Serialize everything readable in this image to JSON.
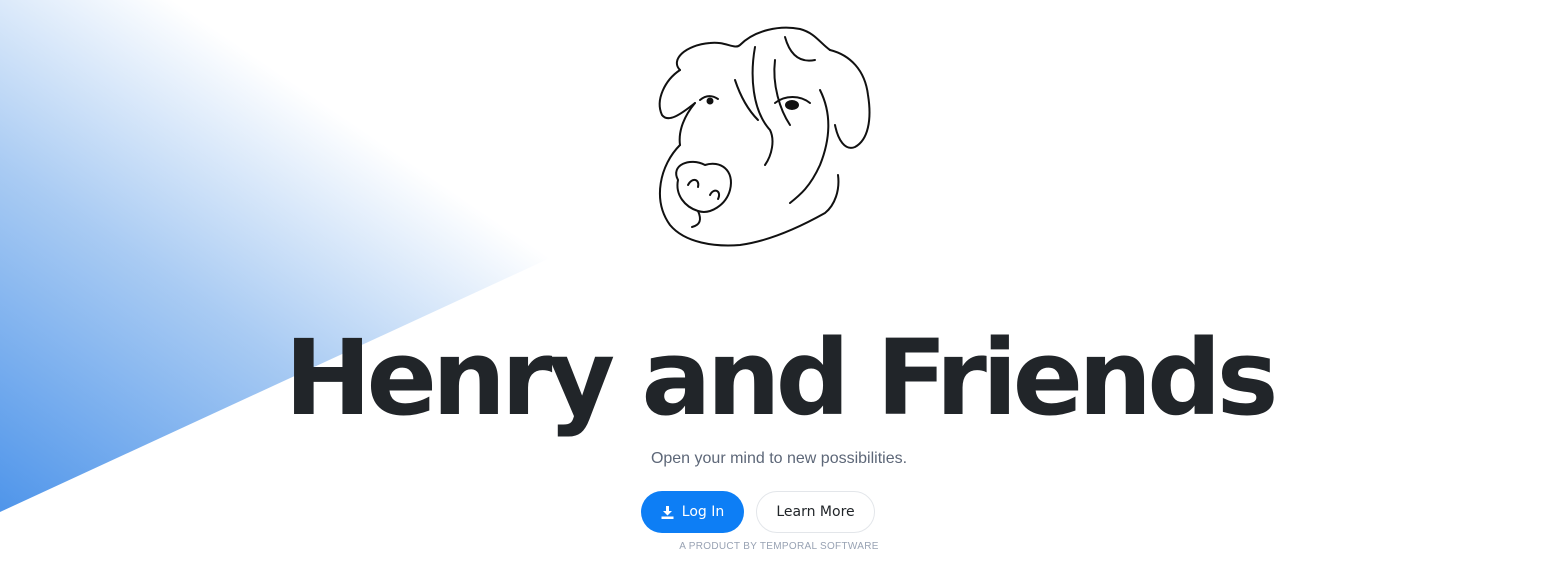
{
  "brand": {
    "logo_icon": "dog-head-icon",
    "accent_color": "#0d7ef5",
    "gradient_color": "#5a9ceb"
  },
  "hero": {
    "title": "Henry and Friends",
    "tagline": "Open your mind to new possibilities."
  },
  "actions": {
    "login_label": "Log In",
    "login_icon": "download-icon",
    "learn_more_label": "Learn More"
  },
  "footer": {
    "credit": "A PRODUCT BY TEMPORAL SOFTWARE"
  }
}
